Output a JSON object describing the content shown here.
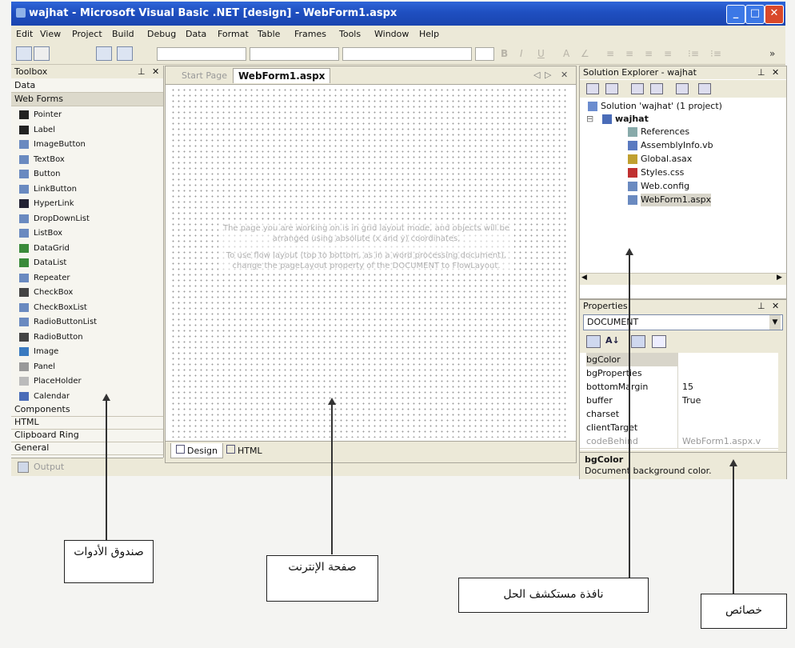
{
  "window": {
    "title": "wajhat - Microsoft Visual Basic .NET [design] - WebForm1.aspx"
  },
  "menu": [
    "Edit",
    "View",
    "Project",
    "Build",
    "Debug",
    "Data",
    "Format",
    "Table",
    "Frames",
    "Tools",
    "Window",
    "Help"
  ],
  "toolbox": {
    "title": "Toolbox",
    "categories_top": [
      "Data",
      "Web Forms"
    ],
    "items": [
      {
        "label": "Pointer",
        "icon": "pointer-icon"
      },
      {
        "label": "Label",
        "icon": "label-icon"
      },
      {
        "label": "ImageButton",
        "icon": "imagebutton-icon"
      },
      {
        "label": "TextBox",
        "icon": "textbox-icon"
      },
      {
        "label": "Button",
        "icon": "button-icon"
      },
      {
        "label": "LinkButton",
        "icon": "linkbutton-icon"
      },
      {
        "label": "HyperLink",
        "icon": "hyperlink-icon"
      },
      {
        "label": "DropDownList",
        "icon": "dropdownlist-icon"
      },
      {
        "label": "ListBox",
        "icon": "listbox-icon"
      },
      {
        "label": "DataGrid",
        "icon": "datagrid-icon"
      },
      {
        "label": "DataList",
        "icon": "datalist-icon"
      },
      {
        "label": "Repeater",
        "icon": "repeater-icon"
      },
      {
        "label": "CheckBox",
        "icon": "checkbox-icon"
      },
      {
        "label": "CheckBoxList",
        "icon": "checkboxlist-icon"
      },
      {
        "label": "RadioButtonList",
        "icon": "radiobuttonlist-icon"
      },
      {
        "label": "RadioButton",
        "icon": "radiobutton-icon"
      },
      {
        "label": "Image",
        "icon": "image-icon"
      },
      {
        "label": "Panel",
        "icon": "panel-icon"
      },
      {
        "label": "PlaceHolder",
        "icon": "placeholder-icon"
      },
      {
        "label": "Calendar",
        "icon": "calendar-icon"
      }
    ],
    "categories_bottom": [
      "Components",
      "HTML",
      "Clipboard Ring",
      "General"
    ],
    "output_tab": "Output"
  },
  "designer": {
    "tabs": [
      "Start Page",
      "WebForm1.aspx"
    ],
    "active_tab": "WebForm1.aspx",
    "message_line1": "The page you are working on is in grid layout mode, and objects will be arranged using absolute (x and y) coordinates.",
    "message_line2": "To use flow layout (top to bottom, as in a word processing document), change the pageLayout property of the DOCUMENT to FlowLayout.",
    "view_tabs": [
      "Design",
      "HTML"
    ]
  },
  "solution_explorer": {
    "title": "Solution Explorer - wajhat",
    "solution": "Solution 'wajhat' (1 project)",
    "project": "wajhat",
    "files": [
      "References",
      "AssemblyInfo.vb",
      "Global.asax",
      "Styles.css",
      "Web.config",
      "WebForm1.aspx"
    ]
  },
  "properties": {
    "title": "Properties",
    "object": "DOCUMENT",
    "rows": [
      {
        "name": "bgColor",
        "value": ""
      },
      {
        "name": "bgProperties",
        "value": ""
      },
      {
        "name": "bottomMargin",
        "value": "15"
      },
      {
        "name": "buffer",
        "value": "True"
      },
      {
        "name": "charset",
        "value": ""
      },
      {
        "name": "clientTarget",
        "value": ""
      },
      {
        "name": "codeBehind",
        "value": "WebForm1.aspx.v"
      }
    ],
    "desc_title": "bgColor",
    "desc_text": "Document background color."
  },
  "callouts": {
    "toolbox": "صندوق الأدوات",
    "webpage": "صفحة الإنترنت",
    "solution": "نافذة مستكشف الحل",
    "properties": "خصائص"
  }
}
